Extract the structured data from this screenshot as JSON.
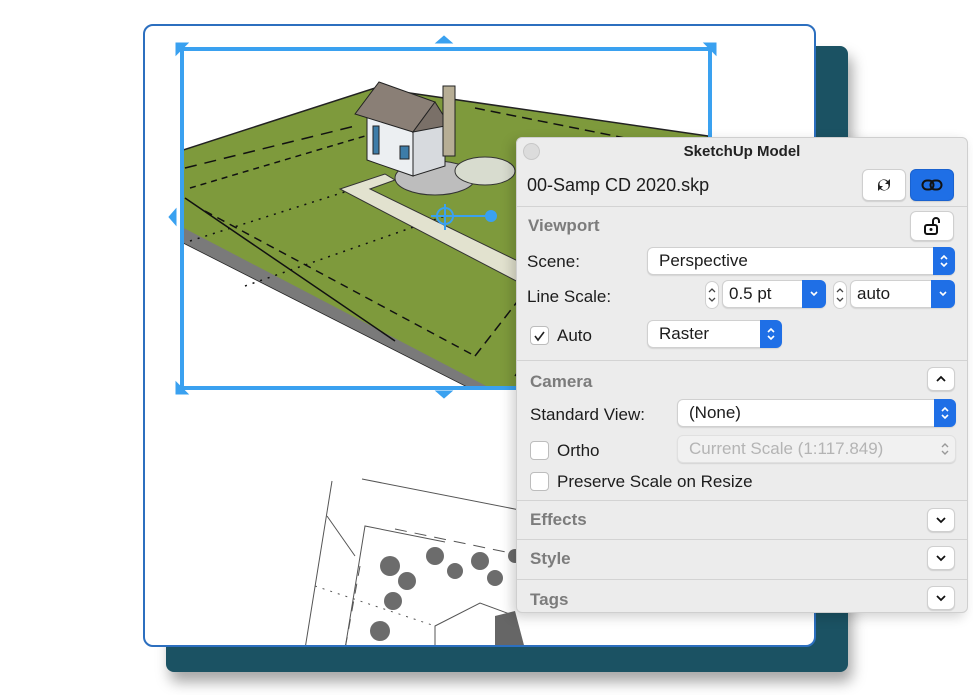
{
  "panel": {
    "title": "SketchUp Model",
    "file_name": "00-Samp CD 2020.skp",
    "buttons": {
      "refresh_icon": "refresh-icon",
      "link_icon": "link-icon",
      "link_active": true
    },
    "viewport": {
      "title": "Viewport",
      "lock_icon": "unlock-icon",
      "scene_label": "Scene:",
      "scene_value": "Perspective",
      "line_scale_label": "Line Scale:",
      "line_scale_value": "0.5 pt",
      "line_scale_secondary": "auto",
      "auto_label": "Auto",
      "auto_checked": true,
      "render_mode": "Raster"
    },
    "camera": {
      "title": "Camera",
      "expanded": true,
      "standard_view_label": "Standard View:",
      "standard_view_value": "(None)",
      "ortho_label": "Ortho",
      "ortho_checked": false,
      "scale_value": "Current Scale (1:117.849)",
      "preserve_label": "Preserve Scale on Resize",
      "preserve_checked": false
    },
    "collapsed_sections": [
      {
        "title": "Effects"
      },
      {
        "title": "Style"
      },
      {
        "title": "Tags"
      }
    ]
  },
  "colors": {
    "accent": "#1f6fe6",
    "selection": "#3aa1f0",
    "backdrop": "#1b5263",
    "card_border": "#2c6fbf",
    "lawn": "#7e9a3c"
  }
}
